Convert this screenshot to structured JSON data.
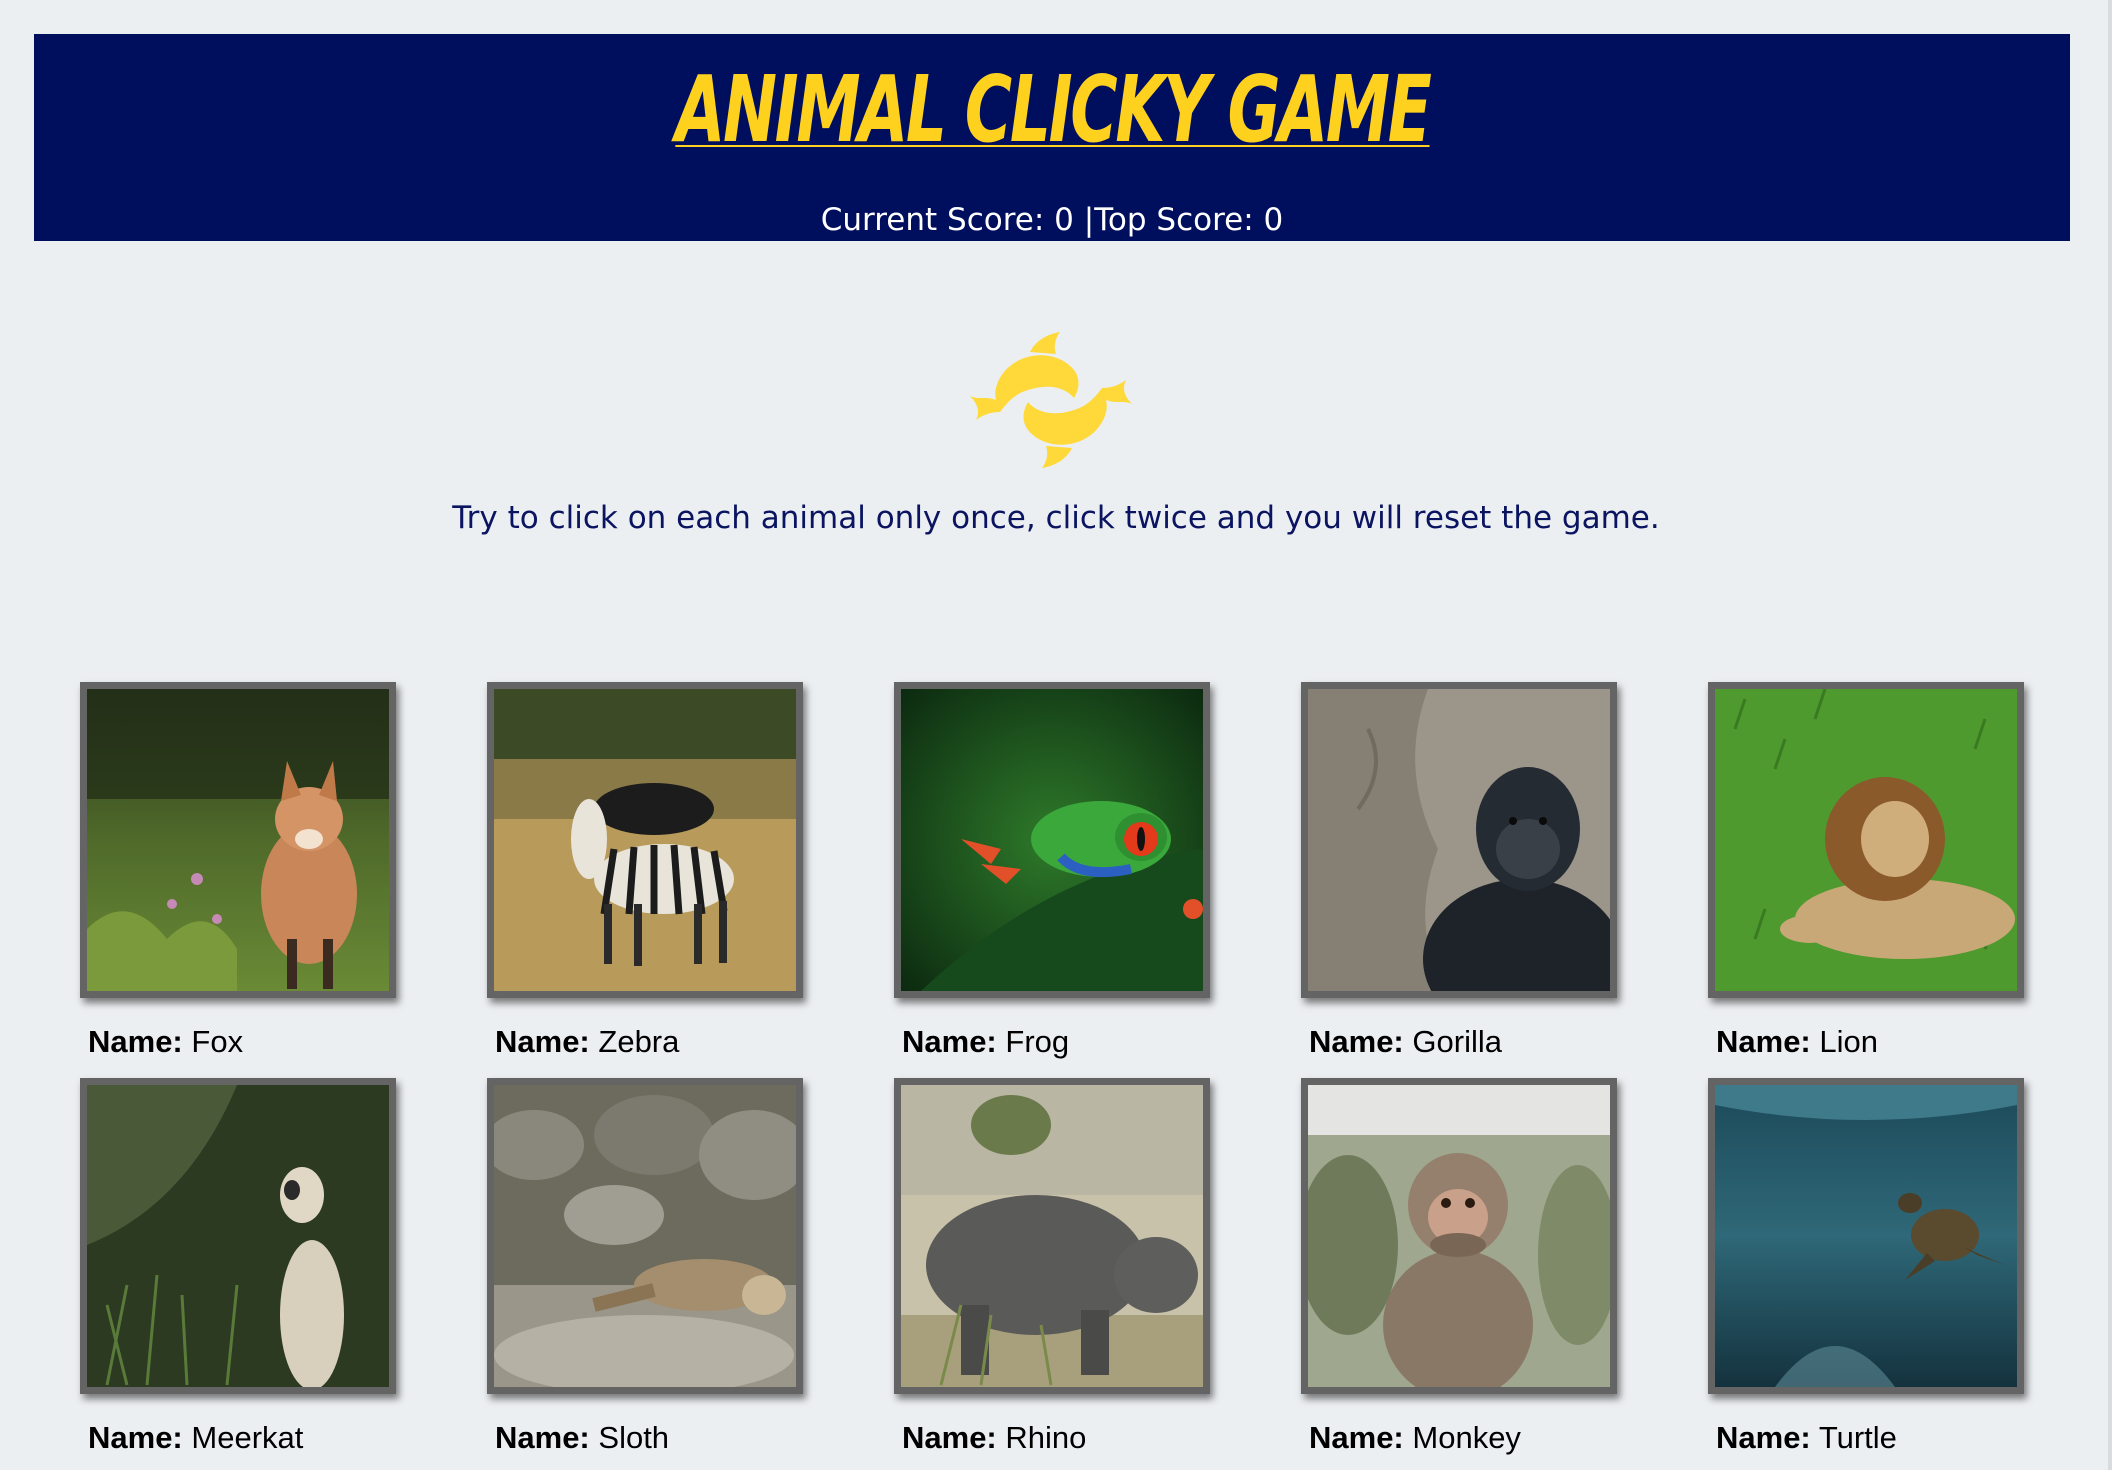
{
  "header": {
    "title": "ANIMAL CLICKY GAME",
    "current_score_label": "Current Score: ",
    "current_score": "0",
    "separator": " |",
    "top_score_label": "Top Score: ",
    "top_score": "0"
  },
  "instructions": "Try to click on each animal only once, click twice and you will reset the game.",
  "name_prefix": "Name:",
  "cards": [
    {
      "name": "Fox"
    },
    {
      "name": "Zebra"
    },
    {
      "name": "Frog"
    },
    {
      "name": "Gorilla"
    },
    {
      "name": "Lion"
    },
    {
      "name": "Meerkat"
    },
    {
      "name": "Sloth"
    },
    {
      "name": "Rhino"
    },
    {
      "name": "Monkey"
    },
    {
      "name": "Turtle"
    }
  ],
  "colors": {
    "header_bg": "#000e5e",
    "title": "#ffd11f",
    "logo": "#ffd83a",
    "instructions_text": "#0a1460",
    "card_border": "#646464"
  },
  "icons": {
    "logo": "fish-swirl-icon"
  }
}
